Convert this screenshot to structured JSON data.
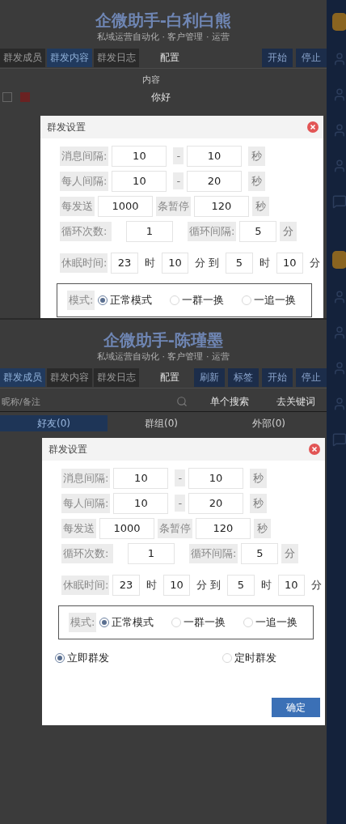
{
  "screens": [
    {
      "title": "企微助手-白利白熊",
      "subtitle": "私域运营自动化 · 客户管理 · 运营",
      "tabs": [
        {
          "label": "群发成员",
          "selected": false
        },
        {
          "label": "群发内容",
          "selected": true
        },
        {
          "label": "群发日志",
          "selected": false
        }
      ],
      "config": "配置",
      "buttons": [
        "开始",
        "停止"
      ],
      "table": {
        "header": "内容",
        "rows": [
          {
            "checked": false,
            "text": "你好"
          }
        ]
      },
      "dialog": {
        "title": "群发设置",
        "rows": [
          {
            "kind": "range",
            "label": "消息间隔:",
            "from": "10",
            "sep": "-",
            "to": "10",
            "unit": "秒"
          },
          {
            "kind": "range",
            "label": "每人间隔:",
            "from": "10",
            "sep": "-",
            "to": "20",
            "unit": "秒"
          },
          {
            "kind": "pause",
            "label": "每发送",
            "count": "1000",
            "mid": "条暂停",
            "seconds": "120",
            "unit": "秒"
          },
          {
            "kind": "loop",
            "label": "循环次数:",
            "count": "1",
            "label2": "循环间隔:",
            "interval": "5",
            "unit": "分"
          },
          {
            "kind": "sleep",
            "label": "休眠时间:",
            "parts": [
              {
                "value": "23",
                "unit": "时"
              },
              {
                "value": "10",
                "unit": "分 到"
              },
              {
                "value": "5",
                "unit": "时"
              },
              {
                "value": "10",
                "unit": "分"
              }
            ]
          }
        ],
        "mode": {
          "label": "模式:",
          "options": [
            {
              "label": "正常模式",
              "selected": true
            },
            {
              "label": "一群一换",
              "selected": false
            },
            {
              "label": "一追一换",
              "selected": false
            }
          ]
        }
      }
    },
    {
      "title": "企微助手-陈瑾墨",
      "subtitle": "私域运营自动化 · 客户管理 · 运营",
      "tabs": [
        {
          "label": "群发成员",
          "selected": true
        },
        {
          "label": "群发内容",
          "selected": false
        },
        {
          "label": "群发日志",
          "selected": false
        }
      ],
      "config": "配置",
      "buttons": [
        "刷新",
        "标签",
        "开始",
        "停止"
      ],
      "search": {
        "placeholder": "昵称/备注",
        "actions": [
          "单个搜索",
          "去关键词"
        ]
      },
      "subtabs": [
        {
          "label": "好友(0)",
          "selected": true
        },
        {
          "label": "群组(0)",
          "selected": false
        },
        {
          "label": "外部(0)",
          "selected": false
        }
      ],
      "dialog": {
        "title": "群发设置",
        "rows": [
          {
            "kind": "range",
            "label": "消息间隔:",
            "from": "10",
            "sep": "-",
            "to": "10",
            "unit": "秒"
          },
          {
            "kind": "range",
            "label": "每人间隔:",
            "from": "10",
            "sep": "-",
            "to": "20",
            "unit": "秒"
          },
          {
            "kind": "pause",
            "label": "每发送",
            "count": "1000",
            "mid": "条暂停",
            "seconds": "120",
            "unit": "秒"
          },
          {
            "kind": "loop",
            "label": "循环次数:",
            "count": "1",
            "label2": "循环间隔:",
            "interval": "5",
            "unit": "分"
          },
          {
            "kind": "sleep",
            "label": "休眠时间:",
            "parts": [
              {
                "value": "23",
                "unit": "时"
              },
              {
                "value": "10",
                "unit": "分 到"
              },
              {
                "value": "5",
                "unit": "时"
              },
              {
                "value": "10",
                "unit": "分"
              }
            ]
          }
        ],
        "mode": {
          "label": "模式:",
          "options": [
            {
              "label": "正常模式",
              "selected": true
            },
            {
              "label": "一群一换",
              "selected": false
            },
            {
              "label": "一追一换",
              "selected": false
            }
          ]
        },
        "send_options": [
          {
            "label": "立即群发",
            "selected": true
          },
          {
            "label": "定时群发",
            "selected": false
          }
        ],
        "confirm": "确定"
      }
    }
  ]
}
